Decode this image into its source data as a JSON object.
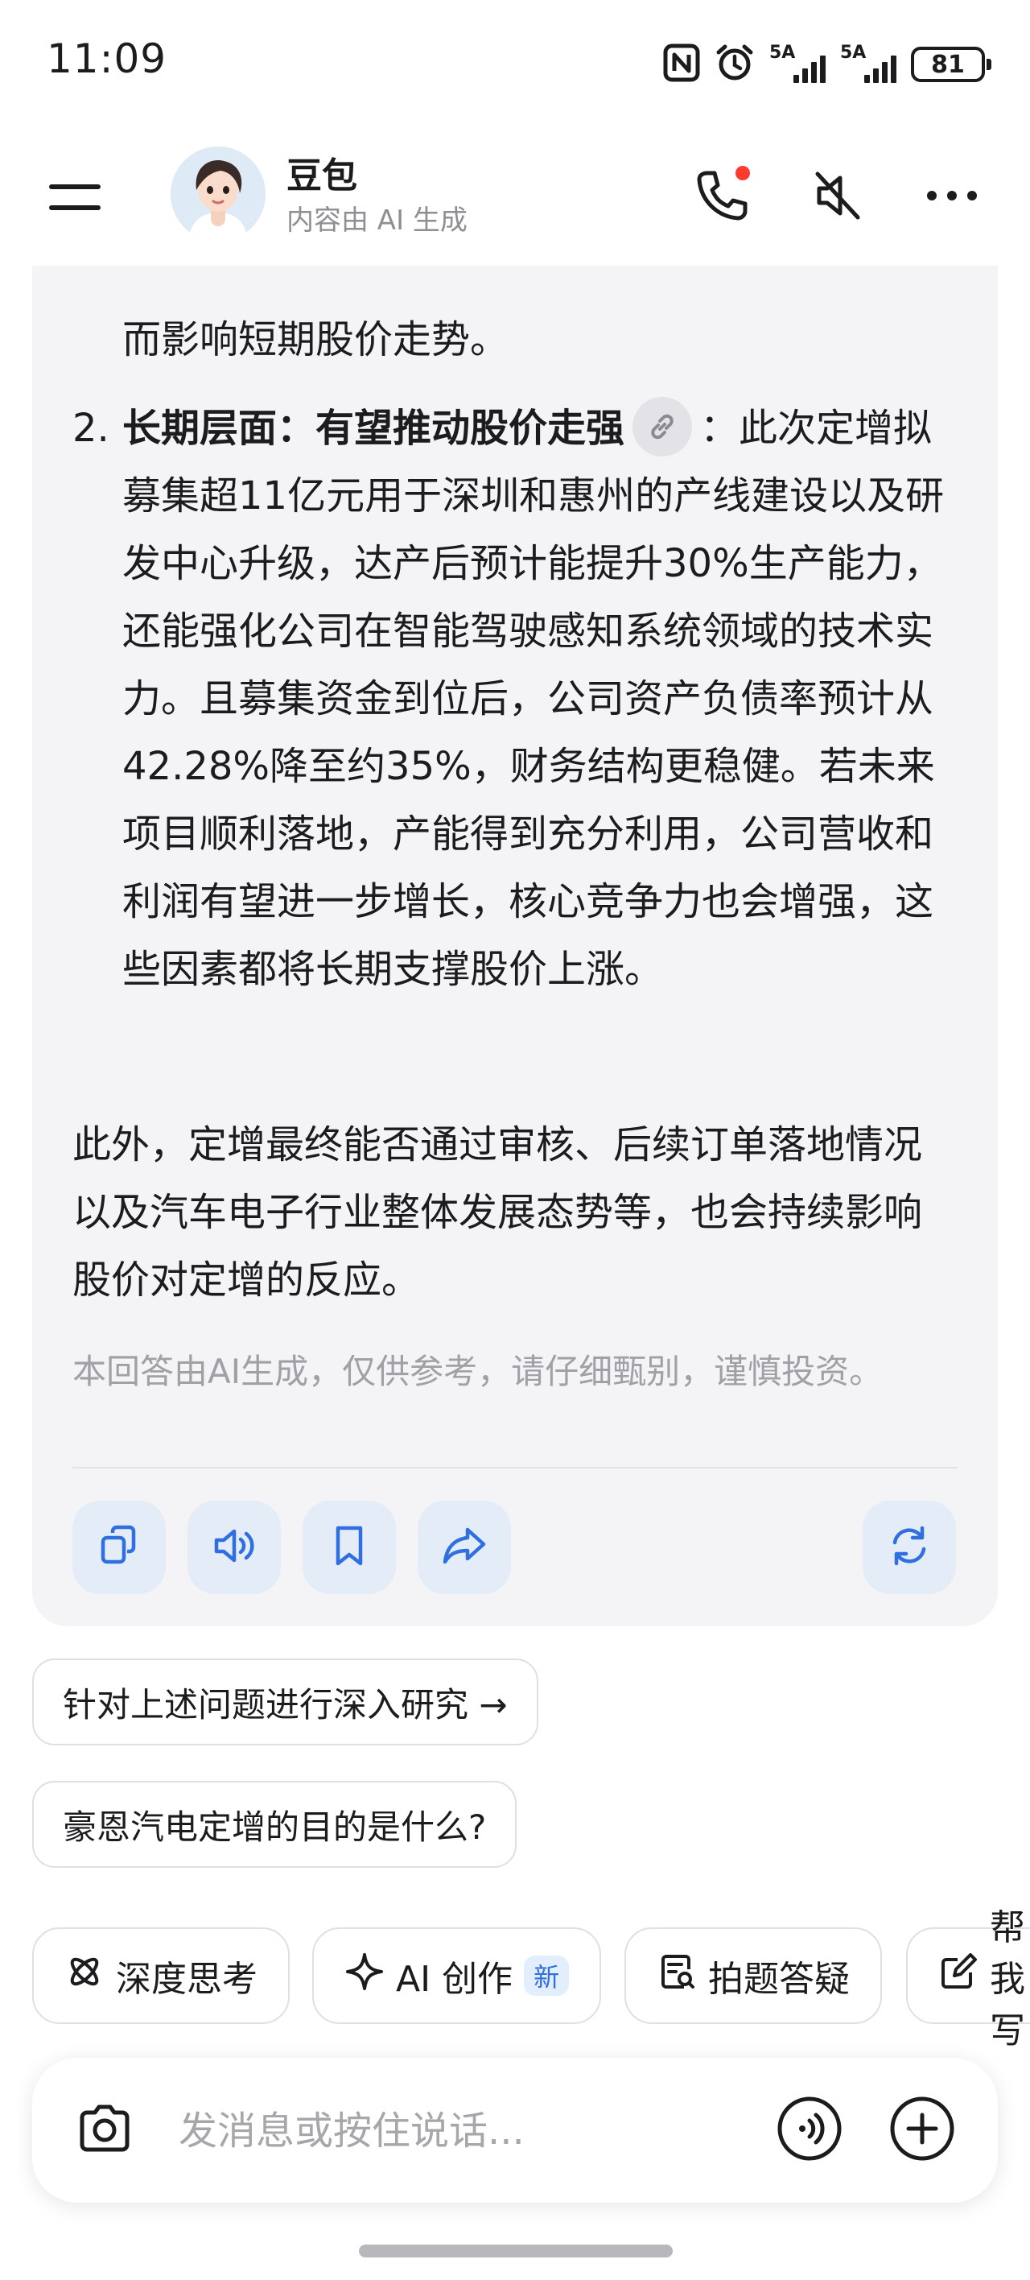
{
  "status_bar": {
    "time": "11:09",
    "signal1_label": "5A",
    "signal2_label": "5A",
    "battery": "81"
  },
  "header": {
    "bot_name": "豆包",
    "subtitle": "内容由 AI 生成"
  },
  "answer": {
    "prev_paragraph_tail": "而影响短期股价走势。",
    "list_item_2": {
      "number": "2.",
      "bold": "长期层面：有望推动股价走强",
      "text": "：此次定增拟募集超11亿元用于深圳和惠州的产线建设以及研发中心升级，达产后预计能提升30%生产能力，还能强化公司在智能驾驶感知系统领域的技术实力。且募集资金到位后，公司资产负债率预计从42.28%降至约35%，财务结构更稳健。若未来项目顺利落地，产能得到充分利用，公司营收和利润有望进一步增长，核心竞争力也会增强，这些因素都将长期支撑股价上涨。"
    },
    "extra_paragraph": "此外，定增最终能否通过审核、后续订单落地情况以及汽车电子行业整体发展态势等，也会持续影响股价对定增的反应。",
    "disclaimer": "本回答由AI生成，仅供参考，请仔细甄别，谨慎投资。"
  },
  "suggestions": [
    "针对上述问题进行深入研究 →",
    "豪恩汽电定增的目的是什么?"
  ],
  "tools": {
    "deep_think": "深度思考",
    "ai_create": "AI 创作",
    "ai_create_badge": "新",
    "photo_qa": "拍题答疑",
    "help_write": "帮我写"
  },
  "input": {
    "placeholder": "发消息或按住说话..."
  },
  "colors": {
    "accent": "#2f6fe0",
    "card_bg": "#f4f4f6",
    "action_bg": "#e4ecf8",
    "notify_dot": "#ff3b30"
  }
}
